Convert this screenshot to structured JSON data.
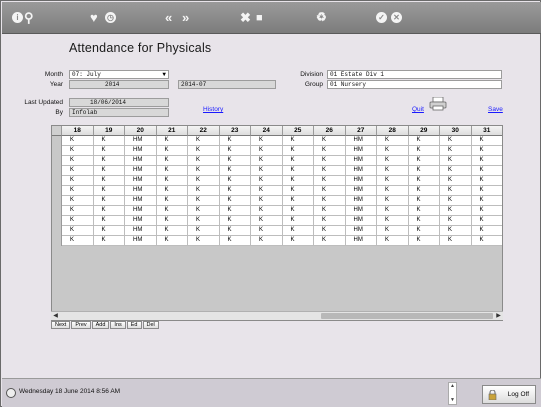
{
  "page": {
    "title": "Attendance for Physicals"
  },
  "toolbar": {
    "icons": [
      "info-icon",
      "search-icon",
      "heart-icon",
      "clock-icon",
      "previous-icon",
      "next-icon",
      "tools-icon",
      "stop-icon",
      "recycle-icon",
      "check-icon",
      "close-icon"
    ]
  },
  "form": {
    "month_label": "Month",
    "month_value": "07: July",
    "year_label": "Year",
    "year_value": "2014",
    "period_value": "2014-07",
    "last_updated_label": "Last Updated",
    "last_updated_value": "18/06/2014",
    "by_label": "By",
    "by_value": "Infolab",
    "division_label": "Division",
    "division_value": "01 Estate Div 1",
    "group_label": "Group",
    "group_value": "01 Nursery"
  },
  "links": {
    "history": "History",
    "quit": "Quit",
    "save": "Save"
  },
  "grid": {
    "columns": [
      "18",
      "19",
      "20",
      "21",
      "22",
      "23",
      "24",
      "25",
      "26",
      "27",
      "28",
      "29",
      "30",
      "31"
    ],
    "rows": [
      [
        "K",
        "K",
        "HM",
        "K",
        "K",
        "K",
        "K",
        "K",
        "K",
        "HM",
        "K",
        "K",
        "K",
        "K"
      ],
      [
        "K",
        "K",
        "HM",
        "K",
        "K",
        "K",
        "K",
        "K",
        "K",
        "HM",
        "K",
        "K",
        "K",
        "K"
      ],
      [
        "K",
        "K",
        "HM",
        "K",
        "K",
        "K",
        "K",
        "K",
        "K",
        "HM",
        "K",
        "K",
        "K",
        "K"
      ],
      [
        "K",
        "K",
        "HM",
        "K",
        "K",
        "K",
        "K",
        "K",
        "K",
        "HM",
        "K",
        "K",
        "K",
        "K"
      ],
      [
        "K",
        "K",
        "HM",
        "K",
        "K",
        "K",
        "K",
        "K",
        "K",
        "HM",
        "K",
        "K",
        "K",
        "K"
      ],
      [
        "K",
        "K",
        "HM",
        "K",
        "K",
        "K",
        "K",
        "K",
        "K",
        "HM",
        "K",
        "K",
        "K",
        "K"
      ],
      [
        "K",
        "K",
        "HM",
        "K",
        "K",
        "K",
        "K",
        "K",
        "K",
        "HM",
        "K",
        "K",
        "K",
        "K"
      ],
      [
        "K",
        "K",
        "HM",
        "K",
        "K",
        "K",
        "K",
        "K",
        "K",
        "HM",
        "K",
        "K",
        "K",
        "K"
      ],
      [
        "K",
        "K",
        "HM",
        "K",
        "K",
        "K",
        "K",
        "K",
        "K",
        "HM",
        "K",
        "K",
        "K",
        "K"
      ],
      [
        "K",
        "K",
        "HM",
        "K",
        "K",
        "K",
        "K",
        "K",
        "K",
        "HM",
        "K",
        "K",
        "K",
        "K"
      ],
      [
        "K",
        "K",
        "HM",
        "K",
        "K",
        "K",
        "K",
        "K",
        "K",
        "HM",
        "K",
        "K",
        "K",
        "K"
      ]
    ]
  },
  "nav_buttons": [
    "Next",
    "Prev",
    "Add",
    "Ins",
    "Ed",
    "Del"
  ],
  "status": {
    "datetime": "Wednesday 18 June 2014 8:56 AM",
    "logoff_label": "Log Off"
  }
}
